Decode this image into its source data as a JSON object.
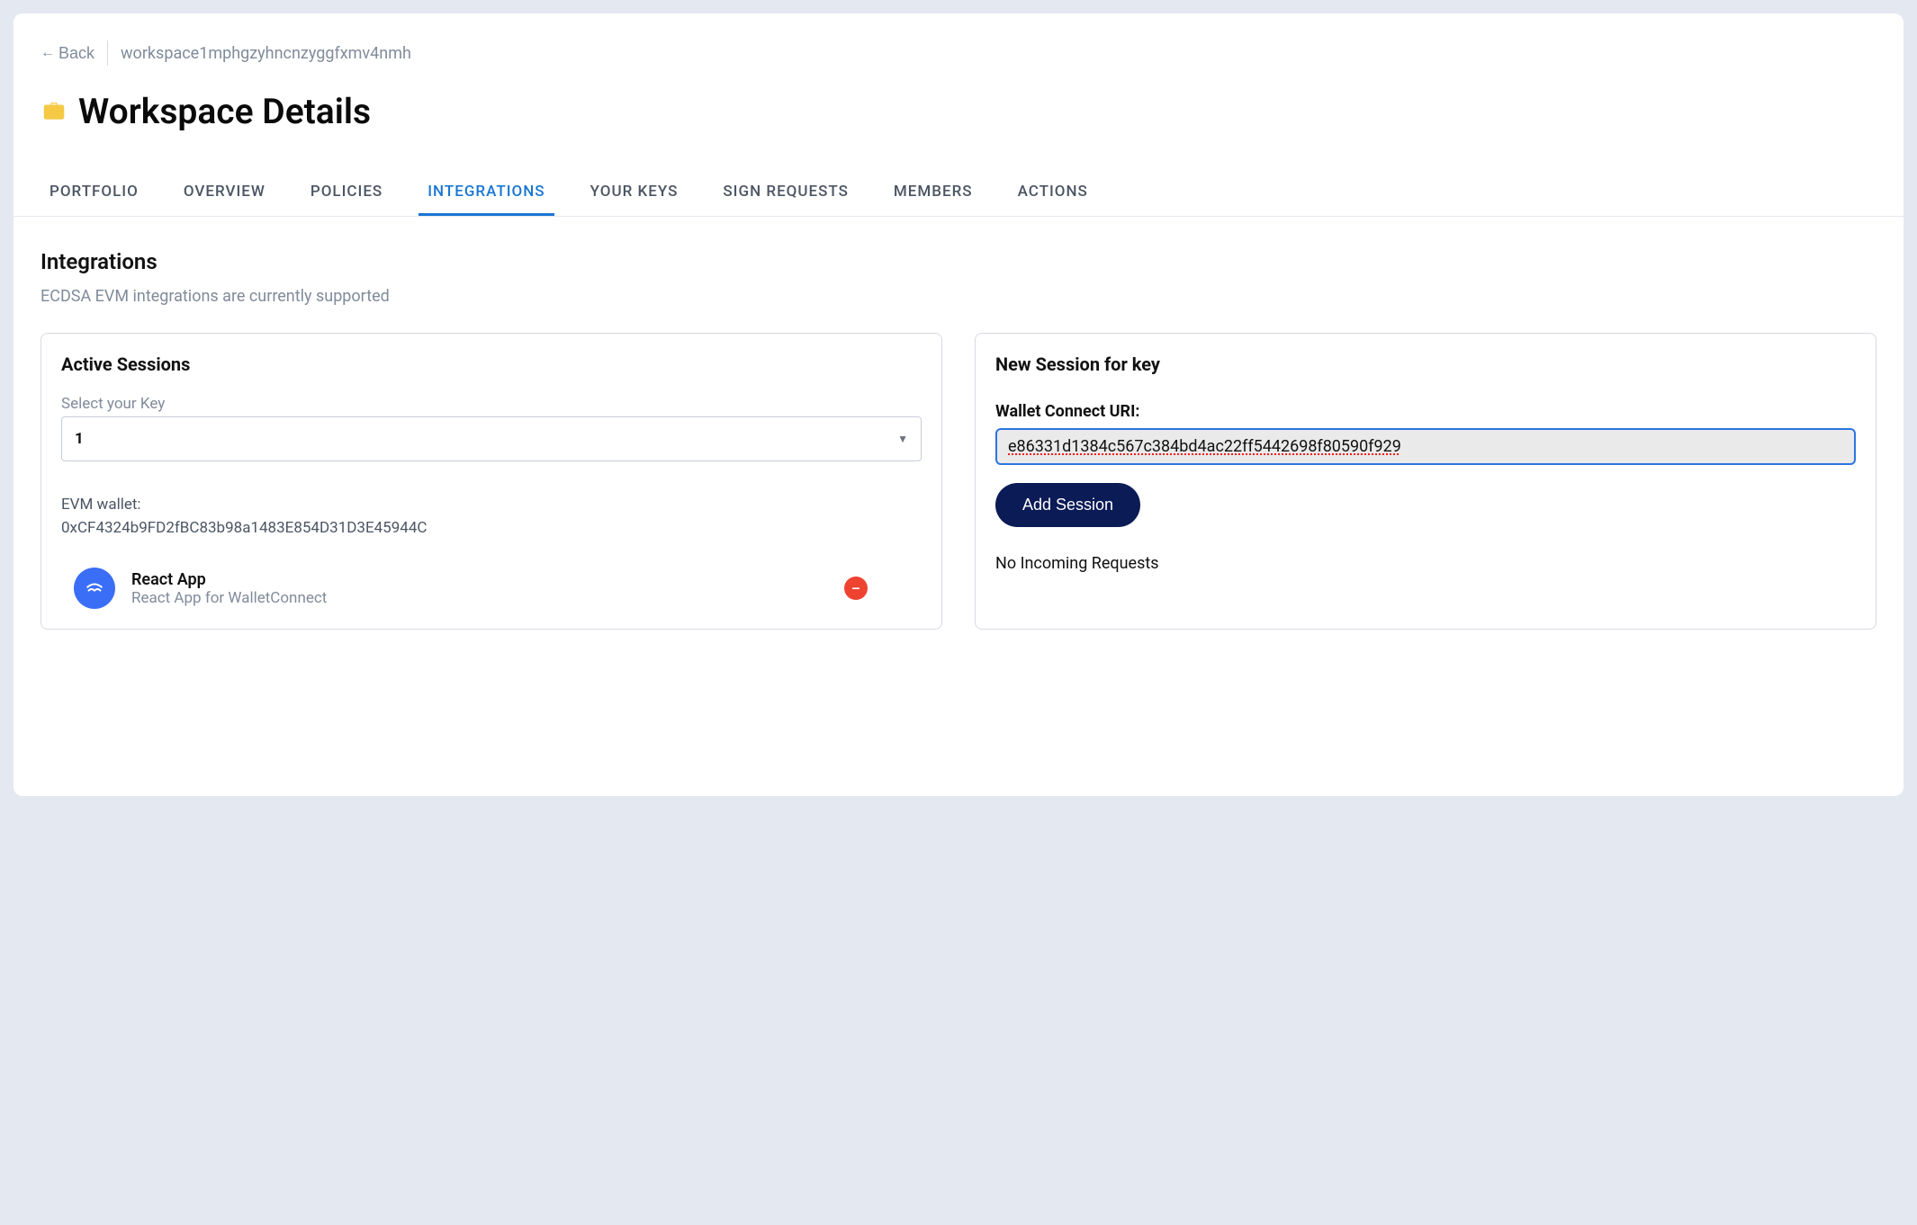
{
  "header": {
    "back_label": "Back",
    "workspace_id": "workspace1mphgzyhncnzyggfxmv4nmh"
  },
  "page_title": "Workspace Details",
  "tabs": [
    {
      "label": "PORTFOLIO",
      "active": false
    },
    {
      "label": "OVERVIEW",
      "active": false
    },
    {
      "label": "POLICIES",
      "active": false
    },
    {
      "label": "INTEGRATIONS",
      "active": true
    },
    {
      "label": "YOUR KEYS",
      "active": false
    },
    {
      "label": "SIGN REQUESTS",
      "active": false
    },
    {
      "label": "MEMBERS",
      "active": false
    },
    {
      "label": "ACTIONS",
      "active": false
    }
  ],
  "integrations": {
    "heading": "Integrations",
    "subheading": "ECDSA EVM integrations are currently supported",
    "active_sessions": {
      "title": "Active Sessions",
      "select_label": "Select your Key",
      "selected_value": "1",
      "wallet_label": "EVM wallet:",
      "wallet_value": "0xCF4324b9FD2fBC83b98a1483E854D31D3E45944C",
      "sessions": [
        {
          "name": "React App",
          "description": "React App for WalletConnect"
        }
      ]
    },
    "new_session": {
      "title": "New Session for key",
      "uri_label": "Wallet Connect URI:",
      "uri_value": "e86331d1384c567c384bd4ac22ff5442698f80590f929",
      "button_label": "Add Session",
      "no_requests": "No Incoming Requests"
    }
  }
}
